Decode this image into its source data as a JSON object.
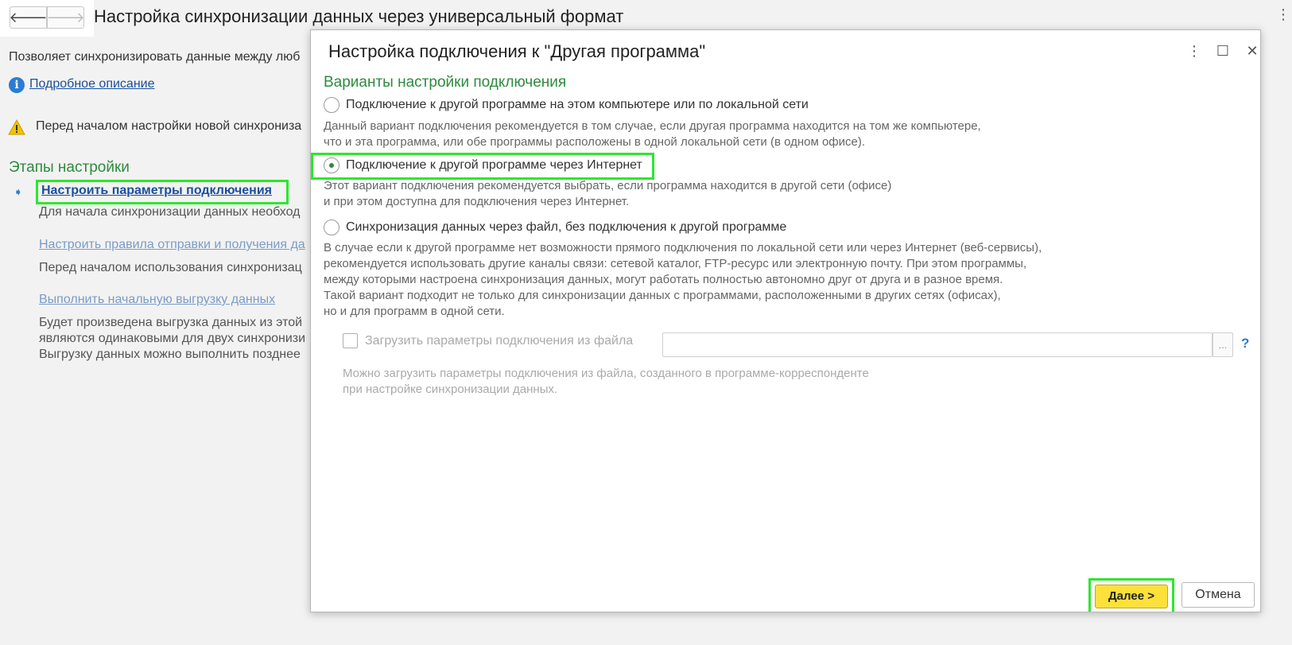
{
  "background": {
    "title": "Настройка синхронизации данных через универсальный формат",
    "description_truncated": "Позволяет синхронизировать данные между люб",
    "info_link": "Подробное описание",
    "warning_truncated": "Перед началом настройки новой синхрониза",
    "steps_title": "Этапы настройки",
    "steps": [
      {
        "link": "Настроить параметры подключения",
        "desc": "Для начала синхронизации данных необход"
      },
      {
        "link": "Настроить правила отправки и получения да",
        "desc": "Перед началом использования синхронизац"
      },
      {
        "link": "Выполнить начальную выгрузку данных",
        "desc_lines": [
          "Будет произведена выгрузка данных из этой",
          "являются одинаковыми для двух синхронизи",
          "Выгрузку данных можно выполнить позднее"
        ]
      }
    ]
  },
  "dialog": {
    "title": "Настройка подключения к \"Другая программа\"",
    "section_title": "Варианты настройки подключения",
    "options": [
      {
        "label": "Подключение к другой программе на этом компьютере или по локальной сети",
        "checked": false,
        "desc_lines": [
          "Данный вариант подключения рекомендуется в том случае, если другая программа находится на том же компьютере,",
          "что и эта программа, или обе программы расположены в одной локальной сети (в одном офисе)."
        ]
      },
      {
        "label": "Подключение к другой программе через Интернет",
        "checked": true,
        "desc_lines": [
          "Этот вариант подключения рекомендуется выбрать, если программа находится в другой сети (офисе)",
          "и при этом доступна для подключения через Интернет."
        ]
      },
      {
        "label": "Синхронизация данных через файл, без подключения к другой программе",
        "checked": false,
        "desc_lines": [
          "В случае если к другой программе нет возможности прямого подключения по локальной сети или через Интернет (веб-сервисы),",
          "рекомендуется использовать другие каналы связи: сетевой каталог, FTP-ресурс или электронную почту. При этом программы,",
          "между которыми настроена синхронизация данных, могут работать полностью автономно друг от друга и в разное время.",
          "Такой вариант подходит не только для синхронизации данных с программами, расположенными в других сетях (офисах),",
          "но и для программ в одной сети."
        ]
      }
    ],
    "load_checkbox_label": "Загрузить параметры подключения из файла",
    "file_value": "",
    "file_select_label": "...",
    "help_label": "?",
    "load_desc_lines": [
      "Можно загрузить параметры подключения из файла, созданного в программе-корреспонденте",
      "при настройке синхронизации данных."
    ],
    "next_label": "Далее >",
    "cancel_label": "Отмена"
  },
  "colors": {
    "accent_green": "#2e8b3e",
    "highlight": "#2ee62e",
    "primary_button": "#fde13a",
    "link": "#1a4f9c"
  }
}
